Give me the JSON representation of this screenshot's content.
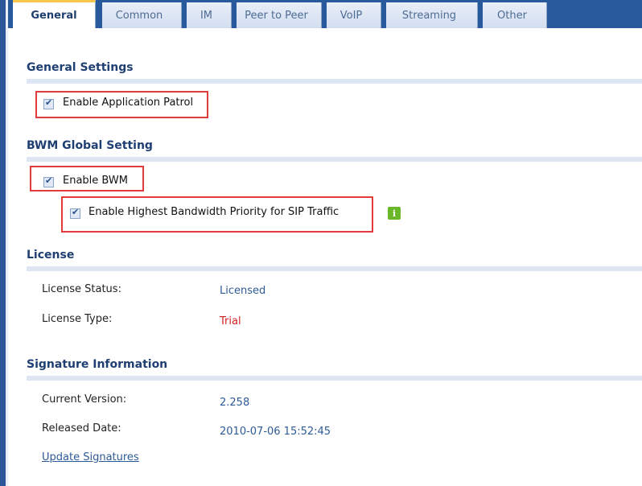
{
  "tabs": [
    {
      "label": "General",
      "active": true
    },
    {
      "label": "Common",
      "active": false
    },
    {
      "label": "IM",
      "active": false
    },
    {
      "label": "Peer to Peer",
      "active": false
    },
    {
      "label": "VoIP",
      "active": false
    },
    {
      "label": "Streaming",
      "active": false
    },
    {
      "label": "Other",
      "active": false
    }
  ],
  "general_settings": {
    "title": "General Settings",
    "enable_app_patrol": {
      "label": "Enable Application Patrol",
      "checked": true
    }
  },
  "bwm": {
    "title": "BWM Global Setting",
    "enable_bwm": {
      "label": "Enable BWM",
      "checked": true
    },
    "sip_priority": {
      "label": "Enable Highest Bandwidth Priority for SIP Traffic",
      "checked": true
    },
    "info_icon": "i"
  },
  "license": {
    "title": "License",
    "status_label": "License Status:",
    "status_value": "Licensed",
    "type_label": "License Type:",
    "type_value": "Trial"
  },
  "signature": {
    "title": "Signature Information",
    "version_label": "Current Version:",
    "version_value": "2.258",
    "date_label": "Released Date:",
    "date_value": "2010-07-06 15:52:45",
    "update_link": "Update Signatures"
  },
  "colors": {
    "accent": "#27599c",
    "highlight_box": "#e23b3b",
    "trial_text": "#d71e1e",
    "info_icon": "#6bb72a"
  }
}
